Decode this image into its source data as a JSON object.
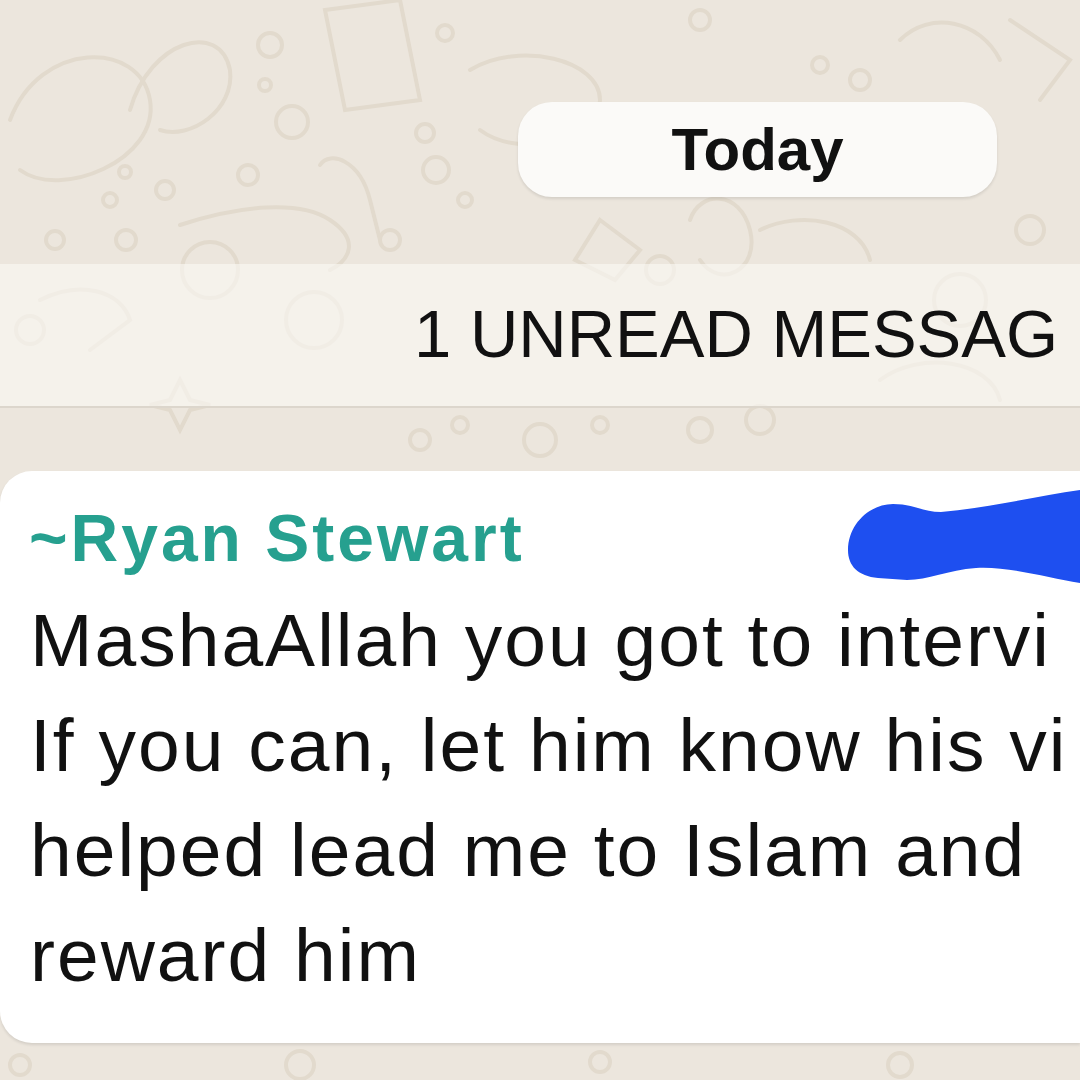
{
  "date_divider": {
    "label": "Today"
  },
  "unread_banner": {
    "label": "1 UNREAD MESSAG"
  },
  "messages": [
    {
      "sender": "~Ryan Stewart",
      "sender_redacted": true,
      "text_lines": [
        "MashaAllah you got to intervi",
        "If you can, let him know his vi",
        "helped lead me to Islam and",
        "reward him"
      ]
    }
  ]
}
